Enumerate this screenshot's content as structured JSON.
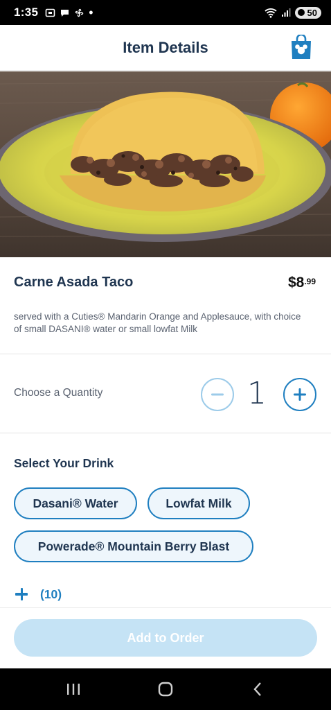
{
  "status_bar": {
    "time": "1:35",
    "battery": "50"
  },
  "header": {
    "title": "Item Details",
    "bag_icon": "shopping-bag-mickey-icon"
  },
  "item": {
    "name": "Carne Asada Taco",
    "price_currency": "$",
    "price_dollars": "8",
    "price_cents": ".99",
    "description": "served with a Cuties® Mandarin Orange and Applesauce, with choice of small DASANI® water or small lowfat Milk"
  },
  "quantity": {
    "label": "Choose a Quantity",
    "value": "1"
  },
  "drink": {
    "title": "Select Your Drink",
    "options": [
      "Dasani® Water",
      "Lowfat Milk",
      "Powerade® Mountain Berry Blast"
    ],
    "more_label": "(10)"
  },
  "actions": {
    "add_to_order": "Add to Order"
  },
  "colors": {
    "accent": "#1f7fc0",
    "title": "#1f3550",
    "disabled_button": "#c5e3f5"
  }
}
